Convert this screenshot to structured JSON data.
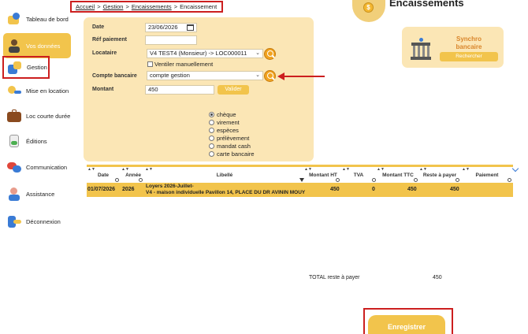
{
  "breadcrumb": {
    "items": [
      "Accueil",
      "Gestion",
      "Encaissements",
      "Encaissement"
    ],
    "separator": ">"
  },
  "header": {
    "title": "Encaissements",
    "icon": "money-box-icon"
  },
  "sidebar": {
    "items": [
      {
        "label": "Tableau de bord",
        "icon": "dashboard-icon"
      },
      {
        "label": "Vos données",
        "icon": "user-icon",
        "active": true
      },
      {
        "label": "Gestion",
        "icon": "management-icon",
        "highlighted": true
      },
      {
        "label": "Mise en location",
        "icon": "key-icon"
      },
      {
        "label": "Loc courte durée",
        "icon": "suitcase-icon"
      },
      {
        "label": "Éditions",
        "icon": "document-icon"
      },
      {
        "label": "Communication",
        "icon": "chat-icon"
      },
      {
        "label": "Assistance",
        "icon": "support-icon"
      },
      {
        "label": "Déconnexion",
        "icon": "logout-icon"
      }
    ]
  },
  "form": {
    "date_label": "Date",
    "date_value": "23/06/2026",
    "ref_label": "Réf paiement",
    "ref_value": "",
    "locataire_label": "Locataire",
    "locataire_value": "V4 TEST4 (Monsieur) -> LOC000011",
    "ventiler_label": "Ventiler manuellement",
    "compte_label": "Compte bancaire",
    "compte_value": "compte gestion",
    "montant_label": "Montant",
    "montant_value": "450",
    "valider_label": "Valider",
    "payment_methods": [
      {
        "label": "chèque",
        "selected": true
      },
      {
        "label": "virement",
        "selected": false
      },
      {
        "label": "espèces",
        "selected": false
      },
      {
        "label": "prélèvement",
        "selected": false
      },
      {
        "label": "mandat cash",
        "selected": false
      },
      {
        "label": "carte bancaire",
        "selected": false
      }
    ]
  },
  "sync": {
    "title_line1": "Synchro",
    "title_line2": "bancaire",
    "button_label": "Rechercher"
  },
  "table": {
    "columns": [
      "Date",
      "Année",
      "Libellé",
      "Montant HT",
      "TVA",
      "Montant TTC",
      "Reste à payer",
      "Paiement"
    ],
    "rows": [
      {
        "date": "01/07/2026",
        "annee": "2026",
        "libelle_line1": "Loyers 2026-Juillet-",
        "libelle_line2": "V4 - maison individuelle Pavillon 14, PLACE DU DR AVININ MOUY",
        "montant_ht": "450",
        "tva": "0",
        "montant_ttc": "450",
        "reste": "450",
        "paiement": ""
      }
    ]
  },
  "totals": {
    "label": "TOTAL reste à payer",
    "value": "450"
  },
  "footer": {
    "save_label": "Enregistrer"
  },
  "colors": {
    "accent": "#f2c44c",
    "panel": "#fbe6b5",
    "highlight": "#cc1f1f",
    "sync_title": "#d9852a"
  }
}
